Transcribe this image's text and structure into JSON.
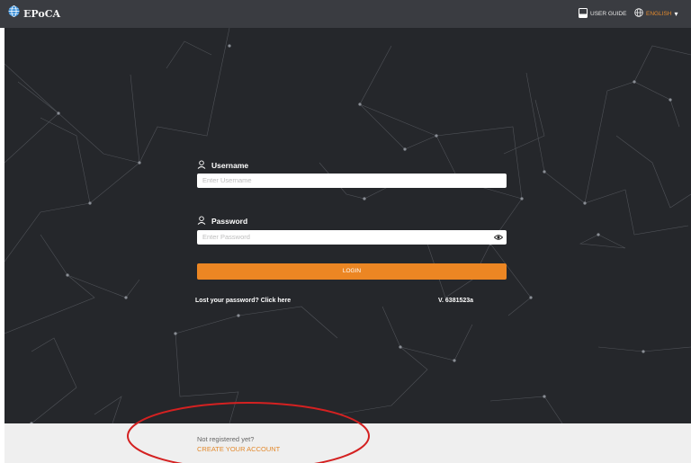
{
  "header": {
    "brand": "EPoCA",
    "user_guide": "USER GUIDE",
    "language": "ENGLISH"
  },
  "form": {
    "username_label": "Username",
    "username_placeholder": "Enter Username",
    "password_label": "Password",
    "password_placeholder": "Enter Password",
    "login_label": "LOGIN",
    "lost_password": "Lost your password? Click here",
    "version": "V. 6381523a"
  },
  "footer": {
    "not_registered": "Not registered yet?",
    "create_account": "CREATE YOUR ACCOUNT"
  },
  "colors": {
    "accent": "#ec8623",
    "topbar": "#3a3c41",
    "hero_bg": "#25272b",
    "annotation": "#d42121"
  }
}
